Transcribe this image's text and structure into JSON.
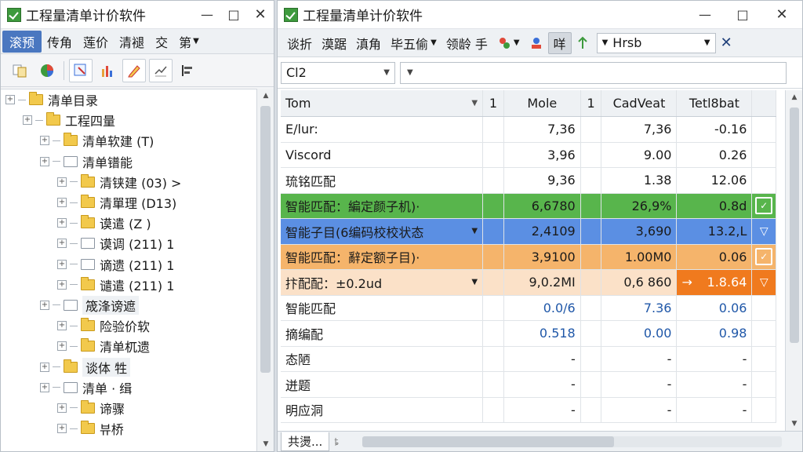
{
  "left_window": {
    "title": "工程量清单计价软件",
    "menu": [
      {
        "label": "滚预",
        "active": true
      },
      {
        "label": "传角"
      },
      {
        "label": "莲价"
      },
      {
        "label": "清褪"
      },
      {
        "label": "交"
      },
      {
        "label": "第",
        "caret": true
      }
    ],
    "tree": [
      {
        "label": "清单目录",
        "depth": 0,
        "kind": "folder"
      },
      {
        "label": "工程四量",
        "depth": 1,
        "kind": "folder"
      },
      {
        "label": "清单软建 (T)",
        "depth": 2,
        "kind": "folder"
      },
      {
        "label": "清单镨能",
        "depth": 2,
        "kind": "doc"
      },
      {
        "label": "清铗建 (03) >",
        "depth": 3,
        "kind": "folder"
      },
      {
        "label": "清單理 (D13)",
        "depth": 3,
        "kind": "folder"
      },
      {
        "label": "谟遣 (Z )",
        "depth": 3,
        "kind": "folder"
      },
      {
        "label": "谟调 (211) 1",
        "depth": 3,
        "kind": "doc"
      },
      {
        "label": "谪遗 (211) 1",
        "depth": 3,
        "kind": "doc"
      },
      {
        "label": "谴遣 (211) 1",
        "depth": 3,
        "kind": "folder"
      },
      {
        "label": "筬浲谤遮",
        "depth": 2,
        "kind": "doc",
        "highlight": true
      },
      {
        "label": "险验价软",
        "depth": 3,
        "kind": "folder"
      },
      {
        "label": "清单杌遗",
        "depth": 3,
        "kind": "folder"
      },
      {
        "label": "谈体 牲",
        "depth": 2,
        "kind": "folder",
        "highlight": true
      },
      {
        "label": "清单 · 缉",
        "depth": 2,
        "kind": "doc"
      },
      {
        "label": "谛骤",
        "depth": 3,
        "kind": "folder"
      },
      {
        "label": "뷰桥",
        "depth": 3,
        "kind": "folder"
      }
    ]
  },
  "right_window": {
    "title": "工程量清单计价软件",
    "toolbar": [
      {
        "label": "谈折"
      },
      {
        "label": "漠踞"
      },
      {
        "label": "滇角"
      },
      {
        "label": "毕五偷",
        "caret": true
      },
      {
        "label": "领龄 手"
      }
    ],
    "toolbar_pressed": "咩",
    "search_value": "Hrsb",
    "cell_ref": "Cl2",
    "grid": {
      "columns": [
        "Tom",
        "1",
        "Mole",
        "1",
        "CadVeat",
        "Tetl8bat"
      ],
      "rows": [
        {
          "name": "E/lur:",
          "v1": "7,36",
          "v2": "7,36",
          "v3": "-0.16",
          "style": ""
        },
        {
          "name": "Viscord",
          "v1": "3,96",
          "v2": "9.00",
          "v3": "0.26",
          "style": ""
        },
        {
          "name": "琉铭匹配",
          "v1": "9,36",
          "v2": "1.38",
          "v3": "12.06",
          "style": ""
        },
        {
          "name": "智能匹配：編定颜子机)·",
          "v1": "6,6780",
          "v2": "26,9%",
          "v3": "0.8d",
          "style": "green",
          "status": "edit"
        },
        {
          "name": "智能子目(6编码校校状态",
          "v1": "2,4109",
          "v2": "3,690",
          "v3": "13.2,L",
          "style": "blue",
          "dropdown": true,
          "status": "tri"
        },
        {
          "name": "智能匹配：辭定额子目)·",
          "v1": "3,9100",
          "v2": "1.00M0",
          "v3": "0.06",
          "style": "orange",
          "status": "edit"
        },
        {
          "name": "抃配配：±0.2ud",
          "v1": "9,0.2MI",
          "v2": "0,6 860",
          "v3": "1.8.64",
          "style": "peach",
          "dropdown": true,
          "arrow": "→",
          "status": "tri-orange"
        },
        {
          "name": "智能匹配",
          "v1": "0.0/6",
          "v2": "7.36",
          "v3": "0.06",
          "style": "blue-num"
        },
        {
          "name": "摘编配",
          "v1": "0.518",
          "v2": "0.00",
          "v3": "0.98",
          "style": "blue-num"
        },
        {
          "name": "态陋",
          "v1": "-",
          "v2": "-",
          "v3": "-",
          "style": ""
        },
        {
          "name": "迸题",
          "v1": "-",
          "v2": "-",
          "v3": "-",
          "style": ""
        },
        {
          "name": "明应洞",
          "v1": "-",
          "v2": "-",
          "v3": "-",
          "style": ""
        }
      ]
    },
    "sheet_tab": "共燙...",
    "sheet_sep": "ȶ"
  },
  "colors": {
    "green": "#58b54c",
    "blue": "#5b8fe3",
    "orange": "#f5b46b",
    "peach": "#fbe1c8",
    "accent": "#4a77c0",
    "number_blue": "#1f57a8"
  }
}
